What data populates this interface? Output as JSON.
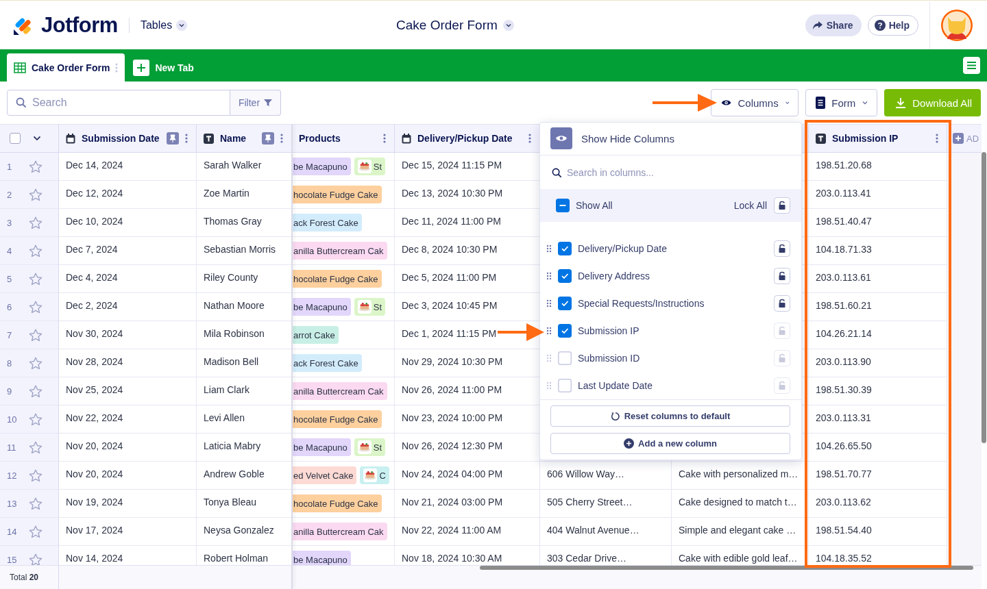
{
  "header": {
    "logo": "Jotform",
    "app_menu": "Tables",
    "title": "Cake Order Form",
    "share": "Share",
    "help": "Help"
  },
  "tabs": [
    {
      "label": "Cake Order Form",
      "selected": true
    }
  ],
  "new_tab": "New Tab",
  "toolbar": {
    "search_placeholder": "Search",
    "filter": "Filter",
    "columns": "Columns",
    "form": "Form",
    "download": "Download All"
  },
  "table": {
    "select_all_checked": false,
    "columns": [
      {
        "label": "Submission Date",
        "kind": "date",
        "pinned": true
      },
      {
        "label": "Name",
        "kind": "text",
        "pinned": true
      },
      {
        "label": "Products",
        "kind": "products",
        "pinned": false
      },
      {
        "label": "Delivery/Pickup Date",
        "kind": "date",
        "pinned": false
      },
      {
        "label": "Submission IP",
        "kind": "text",
        "pinned": false
      }
    ],
    "add_column": "AD",
    "rows": [
      {
        "num": "1",
        "starred": false,
        "submission_date": "Dec 14, 2024",
        "name": "Sarah Walker",
        "products": [
          {
            "label": "be Macapuno",
            "color": "#e2d6fb",
            "kind": "text"
          },
          {
            "label": "St",
            "color": "#dbf5c8"
          }
        ],
        "delivery_date": "Dec 15, 2024 11:15 PM",
        "ip": "198.51.20.68"
      },
      {
        "num": "2",
        "starred": false,
        "submission_date": "Dec 12, 2024",
        "name": "Zoe Martin",
        "products": [
          {
            "label": "hocolate Fudge Cake",
            "color": "#fdd09e",
            "kind": "text"
          }
        ],
        "delivery_date": "Dec 13, 2024 10:30 PM",
        "ip": "203.0.113.41"
      },
      {
        "num": "3",
        "starred": false,
        "submission_date": "Dec 10, 2024",
        "name": "Thomas Gray",
        "products": [
          {
            "label": "ack Forest Cake",
            "color": "#d3ecfb",
            "kind": "text"
          }
        ],
        "delivery_date": "Dec 11, 2024 11:00 PM",
        "ip": "198.51.40.47"
      },
      {
        "num": "4",
        "starred": false,
        "submission_date": "Dec 7, 2024",
        "name": "Sebastian Morris",
        "products": [
          {
            "label": "anilla Buttercream Cak",
            "color": "#fbd9f1",
            "kind": "text"
          }
        ],
        "delivery_date": "Dec 8, 2024 10:30 PM",
        "ip": "104.18.71.33"
      },
      {
        "num": "5",
        "starred": false,
        "submission_date": "Dec 4, 2024",
        "name": "Riley County",
        "products": [
          {
            "label": "hocolate Fudge Cake",
            "color": "#fdd09e",
            "kind": "text"
          }
        ],
        "delivery_date": "Dec 5, 2024 11:00 PM",
        "ip": "203.0.113.61"
      },
      {
        "num": "6",
        "starred": false,
        "submission_date": "Dec 2, 2024",
        "name": "Nathan Moore",
        "products": [
          {
            "label": "be Macapuno",
            "color": "#e2d6fb",
            "kind": "text"
          },
          {
            "label": "St",
            "color": "#dbf5c8"
          }
        ],
        "delivery_date": "Dec 3, 2024 10:45 PM",
        "ip": "198.51.60.21"
      },
      {
        "num": "7",
        "starred": false,
        "submission_date": "Nov 30, 2024",
        "name": "Mila Robinson",
        "products": [
          {
            "label": "arrot Cake",
            "color": "#c8efe5",
            "kind": "text"
          }
        ],
        "delivery_date": "Dec 1, 2024 11:15 PM",
        "ip": "104.26.21.14"
      },
      {
        "num": "8",
        "starred": false,
        "submission_date": "Nov 28, 2024",
        "name": "Madison Bell",
        "products": [
          {
            "label": "ack Forest Cake",
            "color": "#d3ecfb",
            "kind": "text"
          }
        ],
        "delivery_date": "Nov 29, 2024 10:30 PM",
        "ip": "203.0.113.90"
      },
      {
        "num": "9",
        "starred": false,
        "submission_date": "Nov 25, 2024",
        "name": "Liam Clark",
        "products": [
          {
            "label": "anilla Buttercream Cak",
            "color": "#fbd9f1",
            "kind": "text"
          }
        ],
        "delivery_date": "Nov 26, 2024 11:00 PM",
        "ip": "198.51.30.39"
      },
      {
        "num": "10",
        "starred": false,
        "submission_date": "Nov 22, 2024",
        "name": "Levi Allen",
        "products": [
          {
            "label": "hocolate Fudge Cake",
            "color": "#fdd09e",
            "kind": "text"
          }
        ],
        "delivery_date": "Nov 23, 2024 10:00 PM",
        "ip": "203.0.113.31"
      },
      {
        "num": "11",
        "starred": false,
        "submission_date": "Nov 20, 2024",
        "name": "Laticia Mabry",
        "products": [
          {
            "label": "be Macapuno",
            "color": "#e2d6fb",
            "kind": "text"
          },
          {
            "label": "St",
            "color": "#dbf5c8"
          }
        ],
        "delivery_date": "Nov 26, 2024 12:30 PM",
        "ip": "104.26.65.50"
      },
      {
        "num": "12",
        "starred": false,
        "submission_date": "Nov 20, 2024",
        "name": "Andrew Goble",
        "products": [
          {
            "label": "ed Velvet Cake",
            "color": "#fddad3",
            "kind": "text"
          },
          {
            "label": "C",
            "color": "#c9f0f0"
          }
        ],
        "delivery_date": "Nov 24, 2024 04:00 PM",
        "address": "606 Willow Way…",
        "requests": "Cake with personalized m…",
        "ip": "198.51.70.77"
      },
      {
        "num": "13",
        "starred": false,
        "submission_date": "Nov 19, 2024",
        "name": "Tonya Bleau",
        "products": [
          {
            "label": "hocolate Fudge Cake",
            "color": "#fdd09e",
            "kind": "text"
          }
        ],
        "delivery_date": "Nov 21, 2024 03:00 PM",
        "address": "505 Cherry Street…",
        "requests": "Cake designed to match t…",
        "ip": "203.0.113.62"
      },
      {
        "num": "14",
        "starred": false,
        "submission_date": "Nov 17, 2024",
        "name": "Neysa Gonzalez",
        "products": [
          {
            "label": "anilla Buttercream Cak",
            "color": "#fbd9f1",
            "kind": "text"
          }
        ],
        "delivery_date": "Nov 22, 2024 11:00 AM",
        "address": "404 Walnut Avenue…",
        "requests": "Simple and elegant cake …",
        "ip": "198.51.54.40"
      },
      {
        "num": "15",
        "starred": false,
        "submission_date": "Nov 14, 2024",
        "name": "Robert Holman",
        "products": [
          {
            "label": "be Macapuno",
            "color": "#e2d6fb",
            "kind": "text"
          }
        ],
        "delivery_date": "Nov 18, 2024 10:30 AM",
        "address": "303 Cedar Drive…",
        "requests": "Cake with edible gold leaf…",
        "ip": "104.18.35.52"
      }
    ],
    "footer": "Total **20**"
  },
  "columns_menu": {
    "title": "Show Hide Columns",
    "search_placeholder": "Search in columns...",
    "show_all": {
      "label": "Show All",
      "indeterminate": true
    },
    "lock_all": "Lock All",
    "items": [
      {
        "label": "Delivery/Pickup Date",
        "checked": true,
        "lockable": true
      },
      {
        "label": "Delivery Address",
        "checked": true,
        "lockable": true
      },
      {
        "label": "Special Requests/Instructions",
        "checked": true,
        "lockable": true
      },
      {
        "label": "Submission IP",
        "checked": true,
        "lockable": false
      },
      {
        "label": "Submission ID",
        "checked": false,
        "lockable": false
      },
      {
        "label": "Last Update Date",
        "checked": false,
        "lockable": false
      }
    ],
    "reset": "Reset columns to default",
    "add": "Add a new column"
  }
}
